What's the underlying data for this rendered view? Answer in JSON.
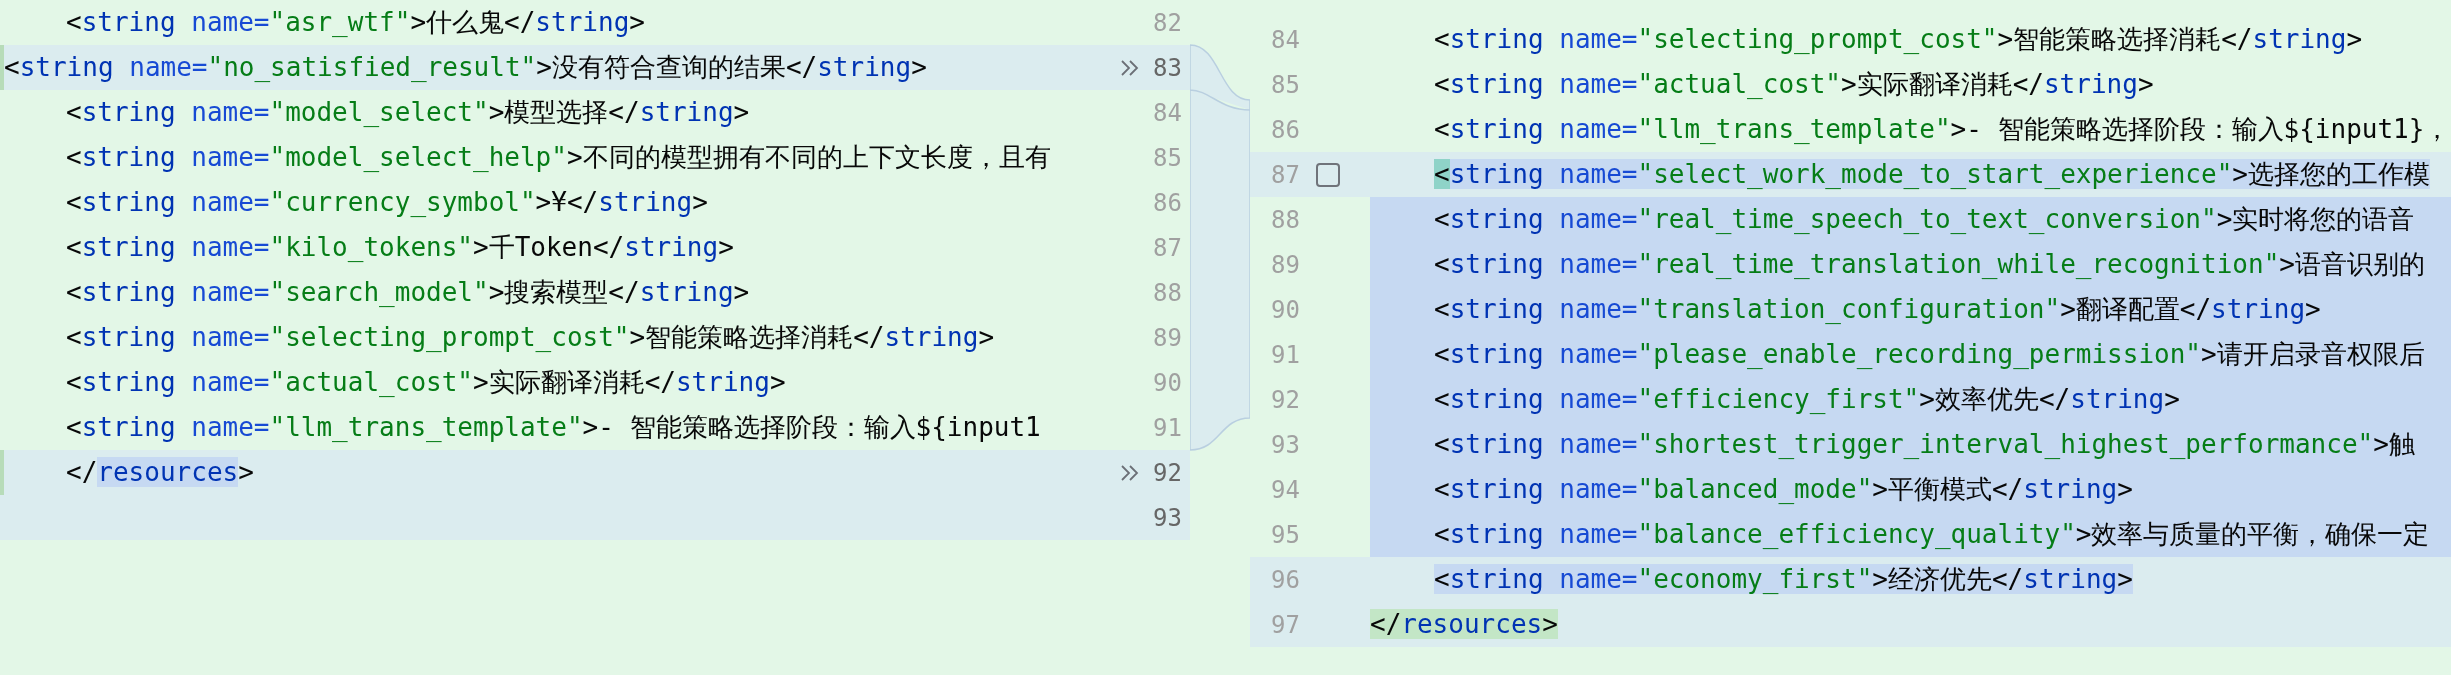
{
  "left": {
    "lines": [
      {
        "number": "82",
        "indent": true,
        "kind": "plain",
        "apply": false,
        "tokens": [
          {
            "kind": "punct",
            "text": "<"
          },
          {
            "kind": "tag",
            "text": "string"
          },
          {
            "kind": "attr",
            "text": " name="
          },
          {
            "kind": "value",
            "text": "\"asr_wtf\""
          },
          {
            "kind": "punct",
            "text": ">"
          },
          {
            "kind": "text",
            "text": "什么鬼"
          },
          {
            "kind": "punct",
            "text": "</"
          },
          {
            "kind": "tag",
            "text": "string"
          },
          {
            "kind": "punct",
            "text": ">"
          }
        ]
      },
      {
        "number": "83",
        "indent": false,
        "kind": "changed",
        "apply": true,
        "tokens": [
          {
            "kind": "punct",
            "text": "<"
          },
          {
            "kind": "tag",
            "text": "string"
          },
          {
            "kind": "attr",
            "text": " name="
          },
          {
            "kind": "value",
            "text": "\"no_satisfied_result\""
          },
          {
            "kind": "punct",
            "text": ">"
          },
          {
            "kind": "text",
            "text": "没有符合查询的结果"
          },
          {
            "kind": "punct",
            "text": "</"
          },
          {
            "kind": "tag",
            "text": "string"
          },
          {
            "kind": "punct",
            "text": ">"
          }
        ]
      },
      {
        "number": "84",
        "indent": true,
        "kind": "plain",
        "apply": false,
        "tokens": [
          {
            "kind": "punct",
            "text": "<"
          },
          {
            "kind": "tag",
            "text": "string"
          },
          {
            "kind": "attr",
            "text": " name="
          },
          {
            "kind": "value",
            "text": "\"model_select\""
          },
          {
            "kind": "punct",
            "text": ">"
          },
          {
            "kind": "text",
            "text": "模型选择"
          },
          {
            "kind": "punct",
            "text": "</"
          },
          {
            "kind": "tag",
            "text": "string"
          },
          {
            "kind": "punct",
            "text": ">"
          }
        ]
      },
      {
        "number": "85",
        "indent": true,
        "kind": "plain",
        "apply": false,
        "tokens": [
          {
            "kind": "punct",
            "text": "<"
          },
          {
            "kind": "tag",
            "text": "string"
          },
          {
            "kind": "attr",
            "text": " name="
          },
          {
            "kind": "value",
            "text": "\"model_select_help\""
          },
          {
            "kind": "punct",
            "text": ">"
          },
          {
            "kind": "text",
            "text": "不同的模型拥有不同的上下文长度，且有"
          }
        ]
      },
      {
        "number": "86",
        "indent": true,
        "kind": "plain",
        "apply": false,
        "tokens": [
          {
            "kind": "punct",
            "text": "<"
          },
          {
            "kind": "tag",
            "text": "string"
          },
          {
            "kind": "attr",
            "text": " name="
          },
          {
            "kind": "value",
            "text": "\"currency_symbol\""
          },
          {
            "kind": "punct",
            "text": ">"
          },
          {
            "kind": "text",
            "text": "¥"
          },
          {
            "kind": "punct",
            "text": "</"
          },
          {
            "kind": "tag",
            "text": "string"
          },
          {
            "kind": "punct",
            "text": ">"
          }
        ]
      },
      {
        "number": "87",
        "indent": true,
        "kind": "plain",
        "apply": false,
        "tokens": [
          {
            "kind": "punct",
            "text": "<"
          },
          {
            "kind": "tag",
            "text": "string"
          },
          {
            "kind": "attr",
            "text": " name="
          },
          {
            "kind": "value",
            "text": "\"kilo_tokens\""
          },
          {
            "kind": "punct",
            "text": ">"
          },
          {
            "kind": "text",
            "text": "千Token"
          },
          {
            "kind": "punct",
            "text": "</"
          },
          {
            "kind": "tag",
            "text": "string"
          },
          {
            "kind": "punct",
            "text": ">"
          }
        ]
      },
      {
        "number": "88",
        "indent": true,
        "kind": "plain",
        "apply": false,
        "tokens": [
          {
            "kind": "punct",
            "text": "<"
          },
          {
            "kind": "tag",
            "text": "string"
          },
          {
            "kind": "attr",
            "text": " name="
          },
          {
            "kind": "value",
            "text": "\"search_model\""
          },
          {
            "kind": "punct",
            "text": ">"
          },
          {
            "kind": "text",
            "text": "搜索模型"
          },
          {
            "kind": "punct",
            "text": "</"
          },
          {
            "kind": "tag",
            "text": "string"
          },
          {
            "kind": "punct",
            "text": ">"
          }
        ]
      },
      {
        "number": "89",
        "indent": true,
        "kind": "plain",
        "apply": false,
        "tokens": [
          {
            "kind": "punct",
            "text": "<"
          },
          {
            "kind": "tag",
            "text": "string"
          },
          {
            "kind": "attr",
            "text": " name="
          },
          {
            "kind": "value",
            "text": "\"selecting_prompt_cost\""
          },
          {
            "kind": "punct",
            "text": ">"
          },
          {
            "kind": "text",
            "text": "智能策略选择消耗"
          },
          {
            "kind": "punct",
            "text": "</"
          },
          {
            "kind": "tag",
            "text": "string"
          },
          {
            "kind": "punct",
            "text": ">"
          }
        ]
      },
      {
        "number": "90",
        "indent": true,
        "kind": "plain",
        "apply": false,
        "tokens": [
          {
            "kind": "punct",
            "text": "<"
          },
          {
            "kind": "tag",
            "text": "string"
          },
          {
            "kind": "attr",
            "text": " name="
          },
          {
            "kind": "value",
            "text": "\"actual_cost\""
          },
          {
            "kind": "punct",
            "text": ">"
          },
          {
            "kind": "text",
            "text": "实际翻译消耗"
          },
          {
            "kind": "punct",
            "text": "</"
          },
          {
            "kind": "tag",
            "text": "string"
          },
          {
            "kind": "punct",
            "text": ">"
          }
        ]
      },
      {
        "number": "91",
        "indent": true,
        "kind": "plain",
        "apply": false,
        "tokens": [
          {
            "kind": "punct",
            "text": "<"
          },
          {
            "kind": "tag",
            "text": "string"
          },
          {
            "kind": "attr",
            "text": " name="
          },
          {
            "kind": "value",
            "text": "\"llm_trans_template\""
          },
          {
            "kind": "punct",
            "text": ">"
          },
          {
            "kind": "text",
            "text": "- 智能策略选择阶段：输入${input1"
          }
        ]
      },
      {
        "number": "92",
        "indent": true,
        "kind": "changed",
        "apply": true,
        "tokens": [
          {
            "kind": "punct",
            "text": "</"
          },
          {
            "kind": "tag",
            "text": "resources",
            "selected": true
          },
          {
            "kind": "punct",
            "text": ">"
          }
        ]
      },
      {
        "number": "93",
        "kind": "changed",
        "apply": false
      }
    ]
  },
  "right": {
    "lines": [
      {
        "number": "84",
        "indent": true,
        "kind": "plain",
        "tokens": [
          {
            "kind": "punct",
            "text": "<"
          },
          {
            "kind": "tag",
            "text": "string"
          },
          {
            "kind": "attr",
            "text": " name="
          },
          {
            "kind": "value",
            "text": "\"selecting_prompt_cost\""
          },
          {
            "kind": "punct",
            "text": ">"
          },
          {
            "kind": "text",
            "text": "智能策略选择消耗"
          },
          {
            "kind": "punct",
            "text": "</"
          },
          {
            "kind": "tag",
            "text": "string"
          },
          {
            "kind": "punct",
            "text": ">"
          }
        ]
      },
      {
        "number": "85",
        "indent": true,
        "kind": "plain",
        "tokens": [
          {
            "kind": "punct",
            "text": "<"
          },
          {
            "kind": "tag",
            "text": "string"
          },
          {
            "kind": "attr",
            "text": " name="
          },
          {
            "kind": "value",
            "text": "\"actual_cost\""
          },
          {
            "kind": "punct",
            "text": ">"
          },
          {
            "kind": "text",
            "text": "实际翻译消耗"
          },
          {
            "kind": "punct",
            "text": "</"
          },
          {
            "kind": "tag",
            "text": "string"
          },
          {
            "kind": "punct",
            "text": ">"
          }
        ]
      },
      {
        "number": "86",
        "indent": true,
        "kind": "plain",
        "tokens": [
          {
            "kind": "punct",
            "text": "<"
          },
          {
            "kind": "tag",
            "text": "string"
          },
          {
            "kind": "attr",
            "text": " name="
          },
          {
            "kind": "value",
            "text": "\"llm_trans_template\""
          },
          {
            "kind": "punct",
            "text": ">"
          },
          {
            "kind": "text",
            "text": "- 智能策略选择阶段：输入${input1}，"
          }
        ]
      },
      {
        "number": "87",
        "indent": true,
        "kind": "changed",
        "checkbox": {
          "checked": false
        },
        "tokens": [
          {
            "kind": "punct",
            "text": "<",
            "caret": true
          },
          {
            "kind": "tag",
            "text": "string",
            "selected": true
          },
          {
            "kind": "attr",
            "text": " name=",
            "selected": true
          },
          {
            "kind": "value",
            "text": "\"select_work_mode_to_start_experience\"",
            "selected": true
          },
          {
            "kind": "punct",
            "text": ">",
            "selected": true
          },
          {
            "kind": "text",
            "text": "选择您的工作模",
            "selected": true
          }
        ]
      },
      {
        "number": "88",
        "indent": true,
        "kind": "selected",
        "tokens": [
          {
            "kind": "punct",
            "text": "<"
          },
          {
            "kind": "tag",
            "text": "string"
          },
          {
            "kind": "attr",
            "text": " name="
          },
          {
            "kind": "value",
            "text": "\"real_time_speech_to_text_conversion\""
          },
          {
            "kind": "punct",
            "text": ">"
          },
          {
            "kind": "text",
            "text": "实时将您的语音"
          }
        ]
      },
      {
        "number": "89",
        "indent": true,
        "kind": "selected",
        "tokens": [
          {
            "kind": "punct",
            "text": "<"
          },
          {
            "kind": "tag",
            "text": "string"
          },
          {
            "kind": "attr",
            "text": " name="
          },
          {
            "kind": "value",
            "text": "\"real_time_translation_while_recognition\""
          },
          {
            "kind": "punct",
            "text": ">"
          },
          {
            "kind": "text",
            "text": "语音识别的"
          }
        ]
      },
      {
        "number": "90",
        "indent": true,
        "kind": "selected",
        "tokens": [
          {
            "kind": "punct",
            "text": "<"
          },
          {
            "kind": "tag",
            "text": "string"
          },
          {
            "kind": "attr",
            "text": " name="
          },
          {
            "kind": "value",
            "text": "\"translation_configuration\""
          },
          {
            "kind": "punct",
            "text": ">"
          },
          {
            "kind": "text",
            "text": "翻译配置"
          },
          {
            "kind": "punct",
            "text": "</"
          },
          {
            "kind": "tag",
            "text": "string"
          },
          {
            "kind": "punct",
            "text": ">"
          }
        ]
      },
      {
        "number": "91",
        "indent": true,
        "kind": "selected",
        "tokens": [
          {
            "kind": "punct",
            "text": "<"
          },
          {
            "kind": "tag",
            "text": "string"
          },
          {
            "kind": "attr",
            "text": " name="
          },
          {
            "kind": "value",
            "text": "\"please_enable_recording_permission\""
          },
          {
            "kind": "punct",
            "text": ">"
          },
          {
            "kind": "text",
            "text": "请开启录音权限后"
          }
        ]
      },
      {
        "number": "92",
        "indent": true,
        "kind": "selected",
        "tokens": [
          {
            "kind": "punct",
            "text": "<"
          },
          {
            "kind": "tag",
            "text": "string"
          },
          {
            "kind": "attr",
            "text": " name="
          },
          {
            "kind": "value",
            "text": "\"efficiency_first\""
          },
          {
            "kind": "punct",
            "text": ">"
          },
          {
            "kind": "text",
            "text": "效率优先"
          },
          {
            "kind": "punct",
            "text": "</"
          },
          {
            "kind": "tag",
            "text": "string"
          },
          {
            "kind": "punct",
            "text": ">"
          }
        ]
      },
      {
        "number": "93",
        "indent": true,
        "kind": "selected",
        "tokens": [
          {
            "kind": "punct",
            "text": "<"
          },
          {
            "kind": "tag",
            "text": "string"
          },
          {
            "kind": "attr",
            "text": " name="
          },
          {
            "kind": "value",
            "text": "\"shortest_trigger_interval_highest_performance\""
          },
          {
            "kind": "punct",
            "text": ">"
          },
          {
            "kind": "text",
            "text": "触"
          }
        ]
      },
      {
        "number": "94",
        "indent": true,
        "kind": "selected",
        "tokens": [
          {
            "kind": "punct",
            "text": "<"
          },
          {
            "kind": "tag",
            "text": "string"
          },
          {
            "kind": "attr",
            "text": " name="
          },
          {
            "kind": "value",
            "text": "\"balanced_mode\""
          },
          {
            "kind": "punct",
            "text": ">"
          },
          {
            "kind": "text",
            "text": "平衡模式"
          },
          {
            "kind": "punct",
            "text": "</"
          },
          {
            "kind": "tag",
            "text": "string"
          },
          {
            "kind": "punct",
            "text": ">"
          }
        ]
      },
      {
        "number": "95",
        "indent": true,
        "kind": "selected",
        "tokens": [
          {
            "kind": "punct",
            "text": "<"
          },
          {
            "kind": "tag",
            "text": "string"
          },
          {
            "kind": "attr",
            "text": " name="
          },
          {
            "kind": "value",
            "text": "\"balance_efficiency_quality\""
          },
          {
            "kind": "punct",
            "text": ">"
          },
          {
            "kind": "text",
            "text": "效率与质量的平衡，确保一定"
          }
        ]
      },
      {
        "number": "96",
        "indent": true,
        "kind": "changed",
        "tokens": [
          {
            "kind": "punct",
            "text": "<",
            "selected": true
          },
          {
            "kind": "tag",
            "text": "string",
            "selected": true
          },
          {
            "kind": "attr",
            "text": " name=",
            "selected": true
          },
          {
            "kind": "value",
            "text": "\"economy_first\"",
            "selected": true
          },
          {
            "kind": "punct",
            "text": ">",
            "selected": true
          },
          {
            "kind": "text",
            "text": "经济优先",
            "selected": true
          },
          {
            "kind": "punct",
            "text": "</",
            "selected": true
          },
          {
            "kind": "tag",
            "text": "string",
            "selected": true
          },
          {
            "kind": "punct",
            "text": ">",
            "selected": true
          }
        ]
      },
      {
        "number": "97",
        "indent": false,
        "kind": "changed",
        "tokens": [
          {
            "kind": "punct",
            "text": "</",
            "matched": true
          },
          {
            "kind": "tag",
            "text": "resources",
            "matched": true
          },
          {
            "kind": "punct",
            "text": ">",
            "matched": true
          }
        ]
      }
    ]
  }
}
